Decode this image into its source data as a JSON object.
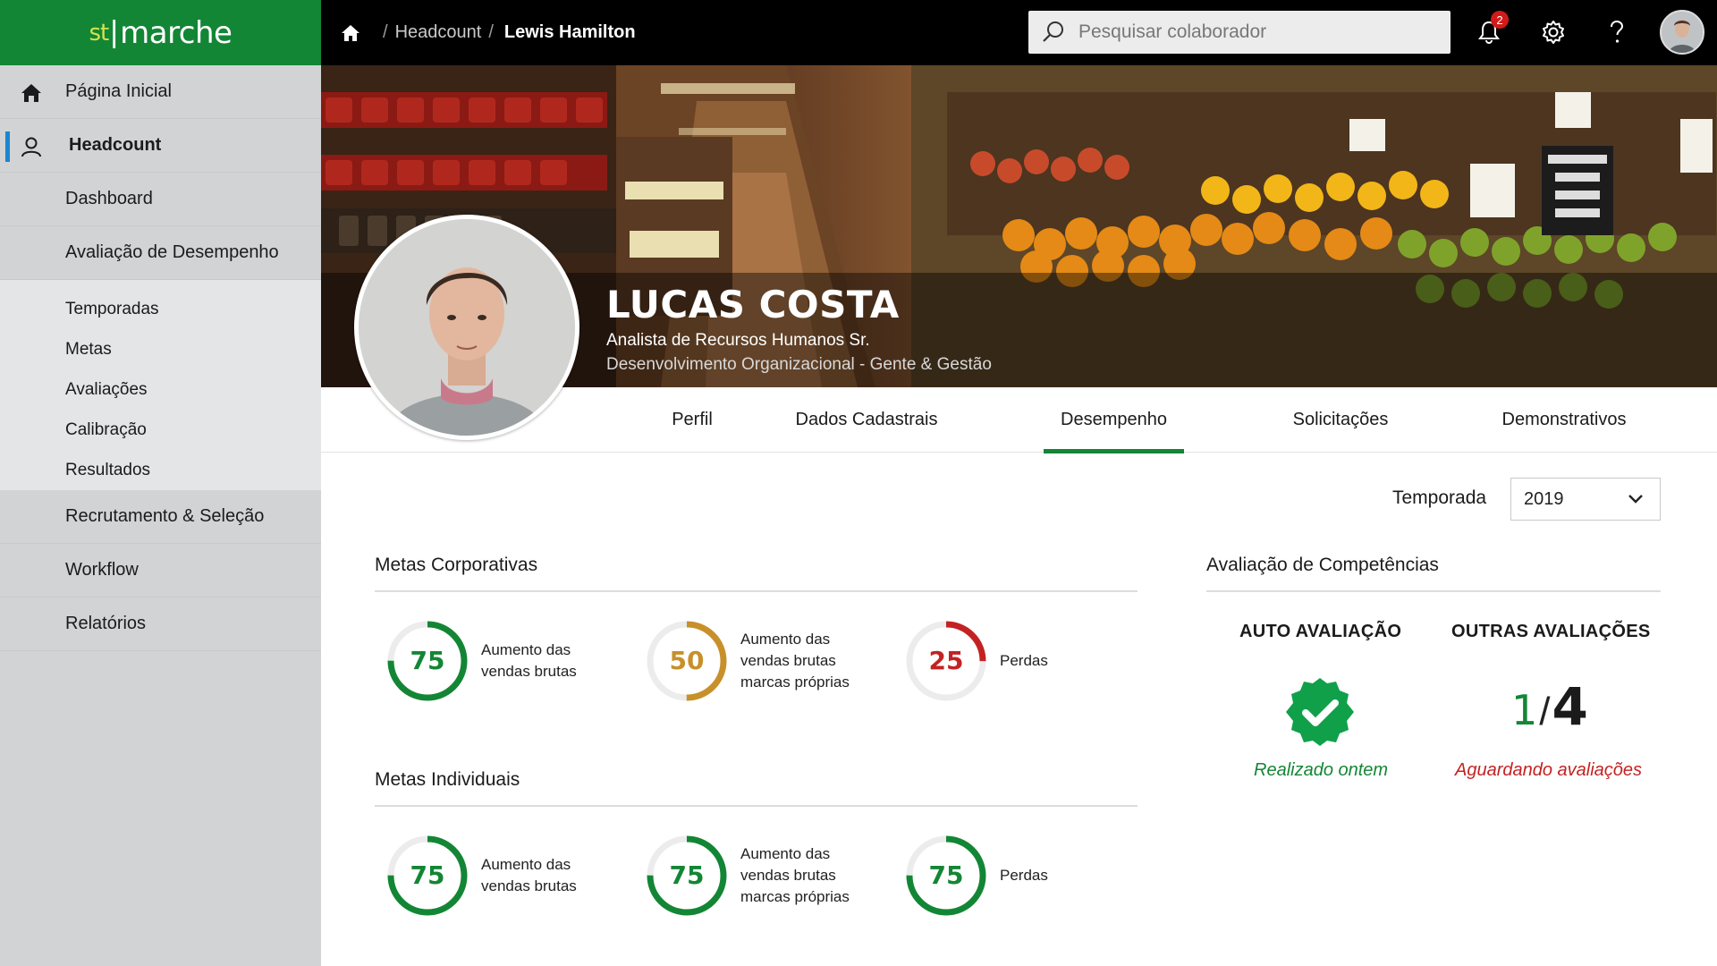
{
  "header": {
    "logo_prefix": "st",
    "logo_name": "marche",
    "breadcrumb": {
      "section": "Headcount",
      "separator": "/",
      "current": "Lewis Hamilton"
    },
    "search_placeholder": "Pesquisar colaborador",
    "notifications_count": "2"
  },
  "sidebar": {
    "home": "Página Inicial",
    "headcount": "Headcount",
    "dashboard": "Dashboard",
    "performance": "Avaliação de Desempenho",
    "sub_items": [
      "Temporadas",
      "Metas",
      "Avaliações",
      "Calibração",
      "Resultados"
    ],
    "recruitment": "Recrutamento & Seleção",
    "workflow": "Workflow",
    "reports": "Relatórios"
  },
  "profile": {
    "name": "LUCAS COSTA",
    "role": "Analista de Recursos Humanos Sr.",
    "department": "Desenvolvimento Organizacional - Gente & Gestão"
  },
  "tabs": {
    "profile": "Perfil",
    "registration": "Dados Cadastrais",
    "performance": "Desempenho",
    "requests": "Solicitações",
    "statements": "Demonstrativos",
    "active": "Desempenho"
  },
  "season": {
    "label": "Temporada",
    "value": "2019"
  },
  "corporate_goals": {
    "title": "Metas Corporativas",
    "items": [
      {
        "value": 75,
        "label": "Aumento das vendas brutas",
        "color": "#138635"
      },
      {
        "value": 50,
        "label": "Aumento das vendas brutas marcas próprias",
        "color": "#c8902a"
      },
      {
        "value": 25,
        "label": "Perdas",
        "color": "#c42222"
      }
    ]
  },
  "individual_goals": {
    "title": "Metas Individuais",
    "items": [
      {
        "value": 75,
        "label": "Aumento das vendas brutas",
        "color": "#138635"
      },
      {
        "value": 75,
        "label": "Aumento das vendas brutas marcas próprias",
        "color": "#138635"
      },
      {
        "value": 75,
        "label": "Perdas",
        "color": "#138635"
      }
    ]
  },
  "competencies": {
    "title": "Avaliação de Competências",
    "self": {
      "heading": "AUTO AVALIAÇÃO",
      "status": "Realizado ontem",
      "status_color": "#138635",
      "icon": "check-badge-icon"
    },
    "others": {
      "heading": "OUTRAS AVALIAÇÕES",
      "done": "1",
      "separator": "/",
      "total": "4",
      "status": "Aguardando avaliações",
      "status_color": "#c42222"
    }
  }
}
